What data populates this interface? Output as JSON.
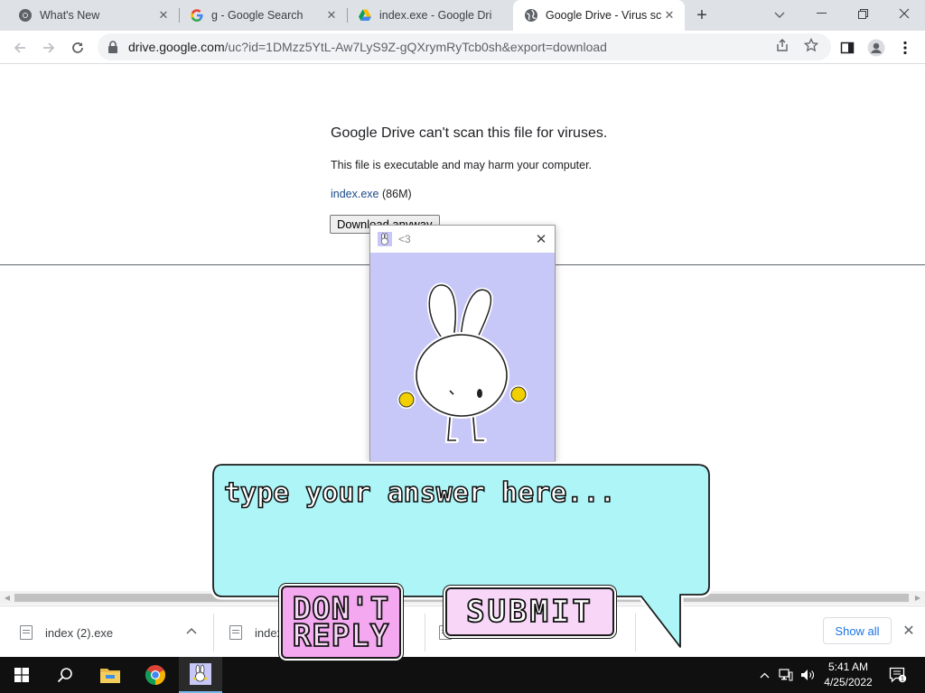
{
  "browser": {
    "tabs": [
      {
        "title": "What's New",
        "icon": "chrome-icon",
        "active": false
      },
      {
        "title": "g - Google Search",
        "icon": "google-g-icon",
        "active": false
      },
      {
        "title": "index.exe - Google Dri",
        "icon": "google-drive-icon",
        "active": false
      },
      {
        "title": "Google Drive - Virus sc",
        "icon": "globe-icon",
        "active": true
      }
    ],
    "new_tab_symbol": "+",
    "url_host": "drive.google.com",
    "url_path": "/uc?id=1DMzz5YtL-Aw7LyS9Z-gQXrymRyTcb0sh&export=download"
  },
  "page": {
    "heading": "Google Drive can't scan this file for viruses.",
    "warning": "This file is executable and may harm your computer.",
    "file_name": "index.exe",
    "file_size": "(86M)",
    "download_button": "Download anyway"
  },
  "popup": {
    "title": "<3",
    "close_symbol": "✕"
  },
  "bubble": {
    "placeholder": "type your answer here...",
    "dont_reply_line1": "DON'T",
    "dont_reply_line2": "REPLY",
    "submit_label": "SUBMIT"
  },
  "downloads": {
    "items": [
      {
        "name": "index (2).exe"
      },
      {
        "name": "index"
      },
      {
        "name": ""
      }
    ],
    "show_all": "Show all",
    "close_symbol": "✕"
  },
  "taskbar": {
    "time": "5:41 AM",
    "date": "4/25/2022",
    "notification_count": "1"
  },
  "colors": {
    "tabstrip_bg": "#dee1e6",
    "link": "#1a4a8a",
    "popup_bg": "#c8c8f8",
    "bubble_fill": "#aef5f7",
    "dont_reply_fill": "#f4a8f0",
    "submit_fill": "#f8d6f8",
    "taskbar_bg": "#101010"
  }
}
